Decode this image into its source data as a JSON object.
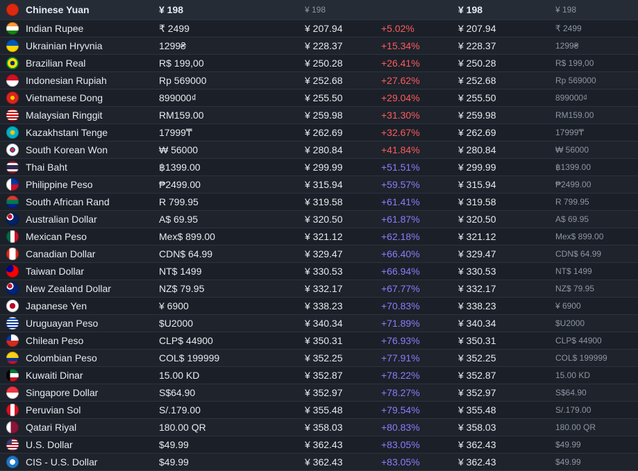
{
  "rows": [
    {
      "name": "Chinese Yuan",
      "local": "¥ 198",
      "converted": "¥ 198",
      "diff": "",
      "converted2": "¥ 198",
      "local2": "¥ 198",
      "diff_color": "",
      "flag_bg": "#de2910",
      "base": true
    },
    {
      "name": "Indian Rupee",
      "local": "₹ 2499",
      "converted": "¥ 207.94",
      "diff": "+5.02%",
      "converted2": "¥ 207.94",
      "local2": "₹ 2499",
      "diff_color": "red",
      "flag_bg": "linear-gradient(#ff9933 33%,#ffffff 33% 66%,#138808 66%)"
    },
    {
      "name": "Ukrainian Hryvnia",
      "local": "1299₴",
      "converted": "¥ 228.37",
      "diff": "+15.34%",
      "converted2": "¥ 228.37",
      "local2": "1299₴",
      "diff_color": "red",
      "flag_bg": "linear-gradient(#0057b7 50%,#ffd700 50%)"
    },
    {
      "name": "Brazilian Real",
      "local": "R$ 199,00",
      "converted": "¥ 250.28",
      "diff": "+26.41%",
      "converted2": "¥ 250.28",
      "local2": "R$ 199,00",
      "diff_color": "red",
      "flag_bg": "radial-gradient(circle,#002776 25%,#ffdf00 26% 55%,#009c3b 56%)"
    },
    {
      "name": "Indonesian Rupiah",
      "local": "Rp 569000",
      "converted": "¥ 252.68",
      "diff": "+27.62%",
      "converted2": "¥ 252.68",
      "local2": "Rp 569000",
      "diff_color": "red",
      "flag_bg": "linear-gradient(#ce1126 50%,#ffffff 50%)"
    },
    {
      "name": "Vietnamese Dong",
      "local": "899000₫",
      "converted": "¥ 255.50",
      "diff": "+29.04%",
      "converted2": "¥ 255.50",
      "local2": "899000₫",
      "diff_color": "red",
      "flag_bg": "radial-gradient(circle,#ffcd00 22%,#da251d 24%)"
    },
    {
      "name": "Malaysian Ringgit",
      "local": "RM159.00",
      "converted": "¥ 259.98",
      "diff": "+31.30%",
      "converted2": "¥ 259.98",
      "local2": "RM159.00",
      "diff_color": "red",
      "flag_bg": "repeating-linear-gradient(#cc0001 0 2px,#ffffff 2px 4px)"
    },
    {
      "name": "Kazakhstani Tenge",
      "local": "17999₸",
      "converted": "¥ 262.69",
      "diff": "+32.67%",
      "converted2": "¥ 262.69",
      "local2": "17999₸",
      "diff_color": "red",
      "flag_bg": "radial-gradient(circle,#fec50c 25%,#00afca 27%)"
    },
    {
      "name": "South Korean Won",
      "local": "₩ 56000",
      "converted": "¥ 280.84",
      "diff": "+41.84%",
      "converted2": "¥ 280.84",
      "local2": "₩ 56000",
      "diff_color": "red",
      "flag_bg": "radial-gradient(circle,#cd2e3a 0 22%,#0047a0 23% 30%,#ffffff 31%)"
    },
    {
      "name": "Thai Baht",
      "local": "฿1399.00",
      "converted": "¥ 299.99",
      "diff": "+51.51%",
      "converted2": "¥ 299.99",
      "local2": "฿1399.00",
      "diff_color": "blue",
      "flag_bg": "linear-gradient(#a51931 16%,#f4f5f8 16% 33%,#2d2a4a 33% 66%,#f4f5f8 66% 83%,#a51931 83%)"
    },
    {
      "name": "Philippine Peso",
      "local": "₱2499.00",
      "converted": "¥ 315.94",
      "diff": "+59.57%",
      "converted2": "¥ 315.94",
      "local2": "₱2499.00",
      "diff_color": "blue",
      "flag_bg": "linear-gradient(90deg,#ffffff 40%,transparent 40%),linear-gradient(#0038a8 50%,#ce1126 50%)"
    },
    {
      "name": "South African Rand",
      "local": "R 799.95",
      "converted": "¥ 319.58",
      "diff": "+61.41%",
      "converted2": "¥ 319.58",
      "local2": "R 799.95",
      "diff_color": "blue",
      "flag_bg": "linear-gradient(#de3831 33%,#007a4d 33% 66%,#002395 66%)"
    },
    {
      "name": "Australian Dollar",
      "local": "A$ 69.95",
      "converted": "¥ 320.50",
      "diff": "+61.87%",
      "converted2": "¥ 320.50",
      "local2": "A$ 69.95",
      "diff_color": "blue",
      "flag_bg": "radial-gradient(circle at 30% 30%,#c8102e 0 18%,#ffffff 19% 28%,#012169 29%)"
    },
    {
      "name": "Mexican Peso",
      "local": "Mex$ 899.00",
      "converted": "¥ 321.12",
      "diff": "+62.18%",
      "converted2": "¥ 321.12",
      "local2": "Mex$ 899.00",
      "diff_color": "blue",
      "flag_bg": "linear-gradient(90deg,#006847 33%,#ffffff 33% 66%,#ce1126 66%)"
    },
    {
      "name": "Canadian Dollar",
      "local": "CDN$ 64.99",
      "converted": "¥ 329.47",
      "diff": "+66.40%",
      "converted2": "¥ 329.47",
      "local2": "CDN$ 64.99",
      "diff_color": "blue",
      "flag_bg": "linear-gradient(90deg,#d52b1e 25%,#ffffff 25% 75%,#d52b1e 75%)"
    },
    {
      "name": "Taiwan Dollar",
      "local": "NT$ 1499",
      "converted": "¥ 330.53",
      "diff": "+66.94%",
      "converted2": "¥ 330.53",
      "local2": "NT$ 1499",
      "diff_color": "blue",
      "flag_bg": "radial-gradient(circle at 28% 28%,#000095 0 30%,transparent 31%),#fe0000"
    },
    {
      "name": "New Zealand Dollar",
      "local": "NZ$ 79.95",
      "converted": "¥ 332.17",
      "diff": "+67.77%",
      "converted2": "¥ 332.17",
      "local2": "NZ$ 79.95",
      "diff_color": "blue",
      "flag_bg": "radial-gradient(circle at 30% 30%,#c8102e 0 18%,#ffffff 19% 28%,#00247d 29%)"
    },
    {
      "name": "Japanese Yen",
      "local": "¥ 6900",
      "converted": "¥ 338.23",
      "diff": "+70.83%",
      "converted2": "¥ 338.23",
      "local2": "¥ 6900",
      "diff_color": "blue",
      "flag_bg": "radial-gradient(circle,#bc002d 32%,#ffffff 34%)"
    },
    {
      "name": "Uruguayan Peso",
      "local": "$U2000",
      "converted": "¥ 340.34",
      "diff": "+71.89%",
      "converted2": "¥ 340.34",
      "local2": "$U2000",
      "diff_color": "blue",
      "flag_bg": "repeating-linear-gradient(#ffffff 0 2px,#0038a8 2px 4px)"
    },
    {
      "name": "Chilean Peso",
      "local": "CLP$ 44900",
      "converted": "¥ 350.31",
      "diff": "+76.93%",
      "converted2": "¥ 350.31",
      "local2": "CLP$ 44900",
      "diff_color": "blue",
      "flag_bg": "linear-gradient(90deg,#0039a6 40%,transparent 40%) top/100% 50% no-repeat,linear-gradient(#ffffff 50%,#d52b1e 50%)"
    },
    {
      "name": "Colombian Peso",
      "local": "COL$ 199999",
      "converted": "¥ 352.25",
      "diff": "+77.91%",
      "converted2": "¥ 352.25",
      "local2": "COL$ 199999",
      "diff_color": "blue",
      "flag_bg": "linear-gradient(#fcd116 50%,#003893 50% 75%,#ce1126 75%)"
    },
    {
      "name": "Kuwaiti Dinar",
      "local": "15.00 KD",
      "converted": "¥ 352.87",
      "diff": "+78.22%",
      "converted2": "¥ 352.87",
      "local2": "15.00 KD",
      "diff_color": "blue",
      "flag_bg": "linear-gradient(90deg,#000000 30%,transparent 30%),linear-gradient(#007a3d 33%,#ffffff 33% 66%,#ce1126 66%)"
    },
    {
      "name": "Singapore Dollar",
      "local": "S$64.90",
      "converted": "¥ 352.97",
      "diff": "+78.27%",
      "converted2": "¥ 352.97",
      "local2": "S$64.90",
      "diff_color": "blue",
      "flag_bg": "linear-gradient(#ef3340 50%,#ffffff 50%)"
    },
    {
      "name": "Peruvian Sol",
      "local": "S/.179.00",
      "converted": "¥ 355.48",
      "diff": "+79.54%",
      "converted2": "¥ 355.48",
      "local2": "S/.179.00",
      "diff_color": "blue",
      "flag_bg": "linear-gradient(90deg,#d91023 33%,#ffffff 33% 66%,#d91023 66%)"
    },
    {
      "name": "Qatari Riyal",
      "local": "180.00 QR",
      "converted": "¥ 358.03",
      "diff": "+80.83%",
      "converted2": "¥ 358.03",
      "local2": "180.00 QR",
      "diff_color": "blue",
      "flag_bg": "linear-gradient(90deg,#ffffff 35%,#8a1538 35%)"
    },
    {
      "name": "U.S. Dollar",
      "local": "$49.99",
      "converted": "¥ 362.43",
      "diff": "+83.05%",
      "converted2": "¥ 362.43",
      "local2": "$49.99",
      "diff_color": "blue",
      "flag_bg": "linear-gradient(90deg,#3c3b6e 45%,transparent 45%) top/100% 50% no-repeat,repeating-linear-gradient(#b22234 0 2px,#ffffff 2px 4px)"
    },
    {
      "name": "CIS - U.S. Dollar",
      "local": "$49.99",
      "converted": "¥ 362.43",
      "diff": "+83.05%",
      "converted2": "¥ 362.43",
      "local2": "$49.99",
      "diff_color": "blue",
      "flag_bg": "radial-gradient(circle,#ffffff 30%,#1f78c8 32%)"
    }
  ]
}
